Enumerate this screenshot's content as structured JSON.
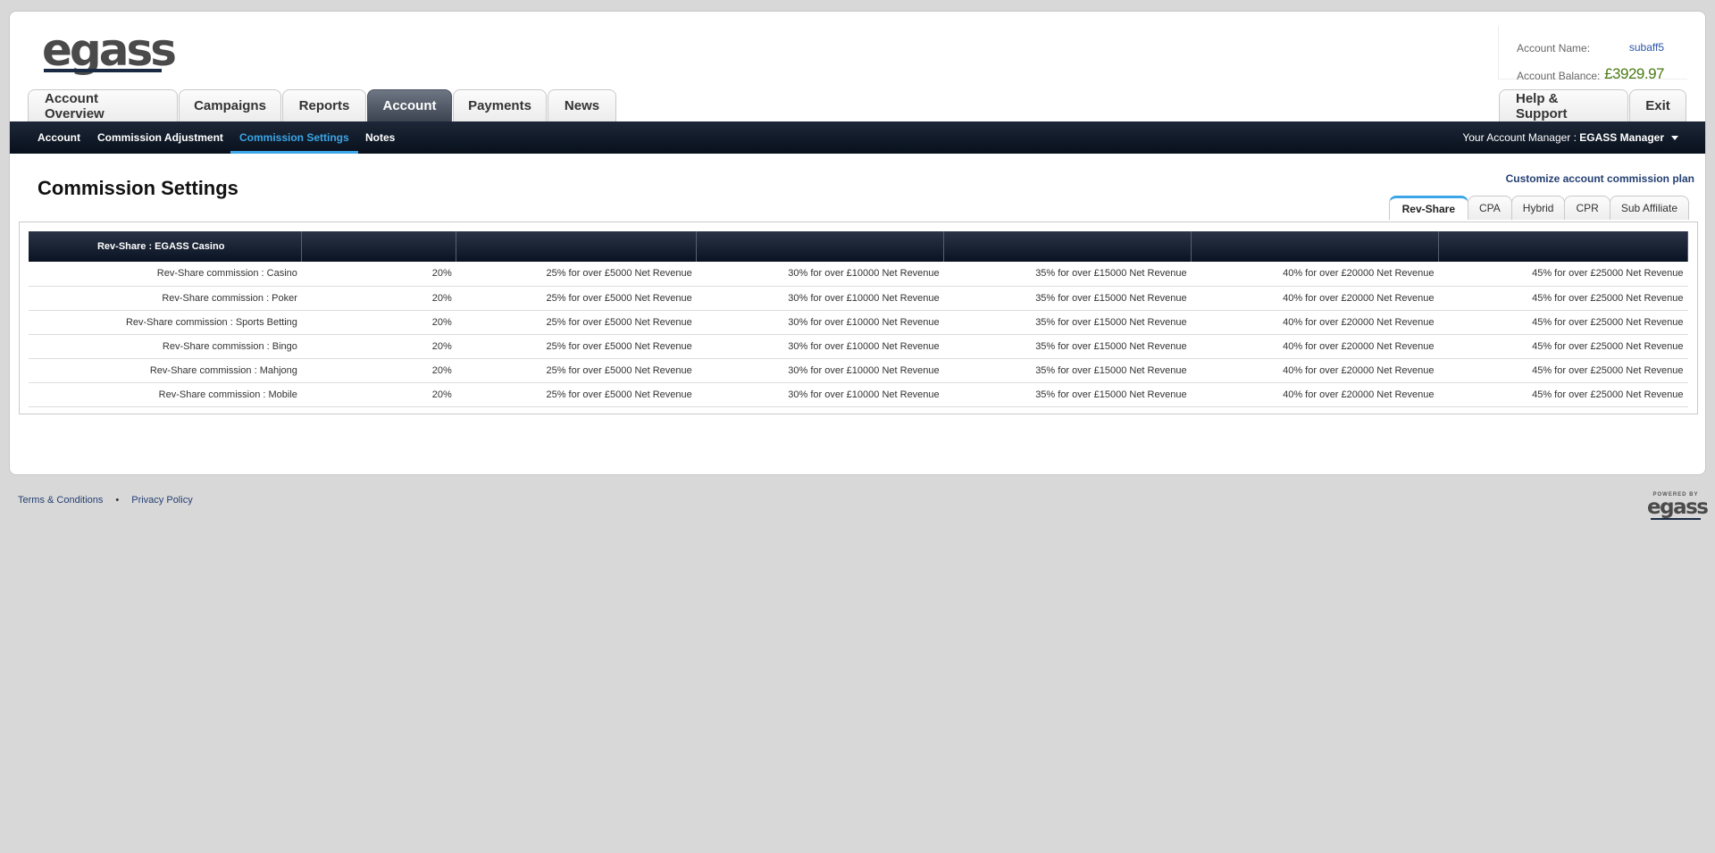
{
  "logo": {
    "text": "egass"
  },
  "account": {
    "name_label": "Account Name:",
    "name_value": "subaff5",
    "balance_label": "Account Balance:",
    "balance_value": "£3929.97"
  },
  "main_tabs": [
    "Account Overview",
    "Campaigns",
    "Reports",
    "Account",
    "Payments",
    "News"
  ],
  "main_tabs_active": "Account",
  "right_tabs": [
    "Help & Support",
    "Exit"
  ],
  "subnav": {
    "items": [
      "Account",
      "Commission Adjustment",
      "Commission Settings",
      "Notes"
    ],
    "active": "Commission Settings",
    "manager_label": "Your Account Manager : ",
    "manager_name": "EGASS Manager"
  },
  "page_title": "Commission Settings",
  "customize_link": "Customize account commission plan",
  "commission_tabs": [
    "Rev-Share",
    "CPA",
    "Hybrid",
    "CPR",
    "Sub Affiliate"
  ],
  "commission_tabs_active": "Rev-Share",
  "table": {
    "header": [
      "Rev-Share : EGASS Casino",
      "",
      "",
      "",
      "",
      "",
      ""
    ],
    "rows": [
      [
        "Rev-Share commission : Casino",
        "20%",
        "25% for over £5000 Net Revenue",
        "30% for over £10000 Net Revenue",
        "35% for over £15000 Net Revenue",
        "40% for over £20000 Net Revenue",
        "45% for over £25000 Net Revenue"
      ],
      [
        "Rev-Share commission : Poker",
        "20%",
        "25% for over £5000 Net Revenue",
        "30% for over £10000 Net Revenue",
        "35% for over £15000 Net Revenue",
        "40% for over £20000 Net Revenue",
        "45% for over £25000 Net Revenue"
      ],
      [
        "Rev-Share commission : Sports Betting",
        "20%",
        "25% for over £5000 Net Revenue",
        "30% for over £10000 Net Revenue",
        "35% for over £15000 Net Revenue",
        "40% for over £20000 Net Revenue",
        "45% for over £25000 Net Revenue"
      ],
      [
        "Rev-Share commission : Bingo",
        "20%",
        "25% for over £5000 Net Revenue",
        "30% for over £10000 Net Revenue",
        "35% for over £15000 Net Revenue",
        "40% for over £20000 Net Revenue",
        "45% for over £25000 Net Revenue"
      ],
      [
        "Rev-Share commission : Mahjong",
        "20%",
        "25% for over £5000 Net Revenue",
        "30% for over £10000 Net Revenue",
        "35% for over £15000 Net Revenue",
        "40% for over £20000 Net Revenue",
        "45% for over £25000 Net Revenue"
      ],
      [
        "Rev-Share commission : Mobile",
        "20%",
        "25% for over £5000 Net Revenue",
        "30% for over £10000 Net Revenue",
        "35% for over £15000 Net Revenue",
        "40% for over £20000 Net Revenue",
        "45% for over £25000 Net Revenue"
      ]
    ]
  },
  "footer": {
    "terms": "Terms & Conditions",
    "separator": "•",
    "privacy": "Privacy Policy",
    "powered_by": "POWERED BY",
    "powered_logo": "egass"
  },
  "colors": {
    "accent": "#3aa6e8",
    "nav_dark": "#0a1322",
    "link": "#243f72",
    "balance": "#4a7a14"
  }
}
